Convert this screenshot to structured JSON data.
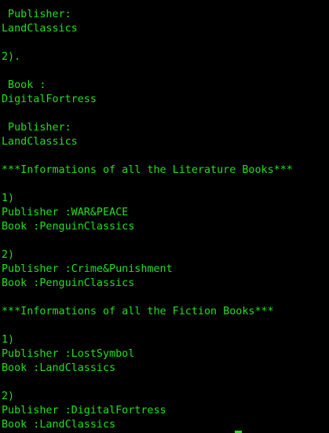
{
  "terminal": {
    "lines": [
      " Publisher:",
      "LandClassics",
      "",
      "2).",
      "",
      " Book :",
      "DigitalFortress",
      "",
      " Publisher:",
      "LandClassics",
      "",
      "***Informations of all the Literature Books***",
      "",
      "1)",
      "Publisher :WAR&PEACE",
      "Book :PenguinClassics",
      "",
      "2)",
      "Publisher :Crime&Punishment",
      "Book :PenguinClassics",
      "",
      "***Informations of all the Fiction Books***",
      "",
      "1)",
      "Publisher :LostSymbol",
      "Book :LandClassics",
      "",
      "2)",
      "Publisher :DigitalFortress",
      "Book :LandClassics"
    ],
    "colors": {
      "background": "#000000",
      "foreground": "#20e020"
    }
  }
}
